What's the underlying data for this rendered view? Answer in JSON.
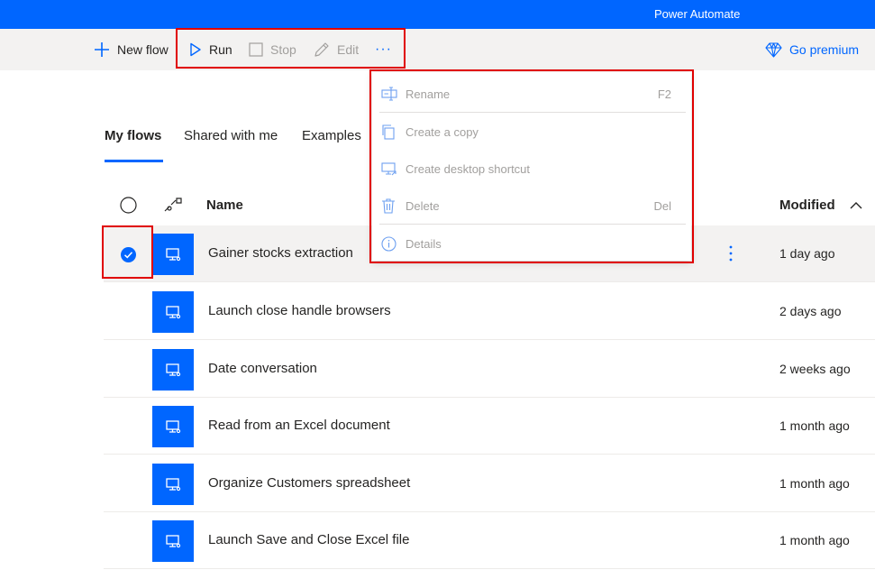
{
  "app": {
    "title": "Power Automate"
  },
  "toolbar": {
    "new_flow": "New flow",
    "run": "Run",
    "stop": "Stop",
    "edit": "Edit",
    "more": "···",
    "premium": "Go premium"
  },
  "tabs": [
    "My flows",
    "Shared with me",
    "Examples"
  ],
  "table": {
    "col_name": "Name",
    "col_modified": "Modified",
    "sort_icon": "chevron-up-icon",
    "rows": [
      {
        "name": "Gainer stocks extraction",
        "modified": "1 day ago",
        "selected": true
      },
      {
        "name": "Launch close handle browsers",
        "modified": "2 days ago",
        "selected": false
      },
      {
        "name": "Date conversation",
        "modified": "2 weeks ago",
        "selected": false
      },
      {
        "name": "Read from an Excel document",
        "modified": "1 month ago",
        "selected": false
      },
      {
        "name": "Organize Customers spreadsheet",
        "modified": "1 month ago",
        "selected": false
      },
      {
        "name": "Launch Save and Close Excel file",
        "modified": "1 month ago",
        "selected": false
      }
    ]
  },
  "context_menu": {
    "items": [
      {
        "label": "Rename",
        "shortcut": "F2",
        "icon": "rename-icon"
      },
      {
        "label": "Create a copy",
        "shortcut": "",
        "icon": "copy-icon"
      },
      {
        "label": "Create desktop shortcut",
        "shortcut": "",
        "icon": "desktop-shortcut-icon"
      },
      {
        "label": "Delete",
        "shortcut": "Del",
        "icon": "delete-icon"
      },
      {
        "label": "Details",
        "shortcut": "",
        "icon": "info-icon"
      }
    ]
  },
  "colors": {
    "accent": "#0066ff",
    "highlight": "#e00000",
    "disabled": "#a19f9d"
  }
}
